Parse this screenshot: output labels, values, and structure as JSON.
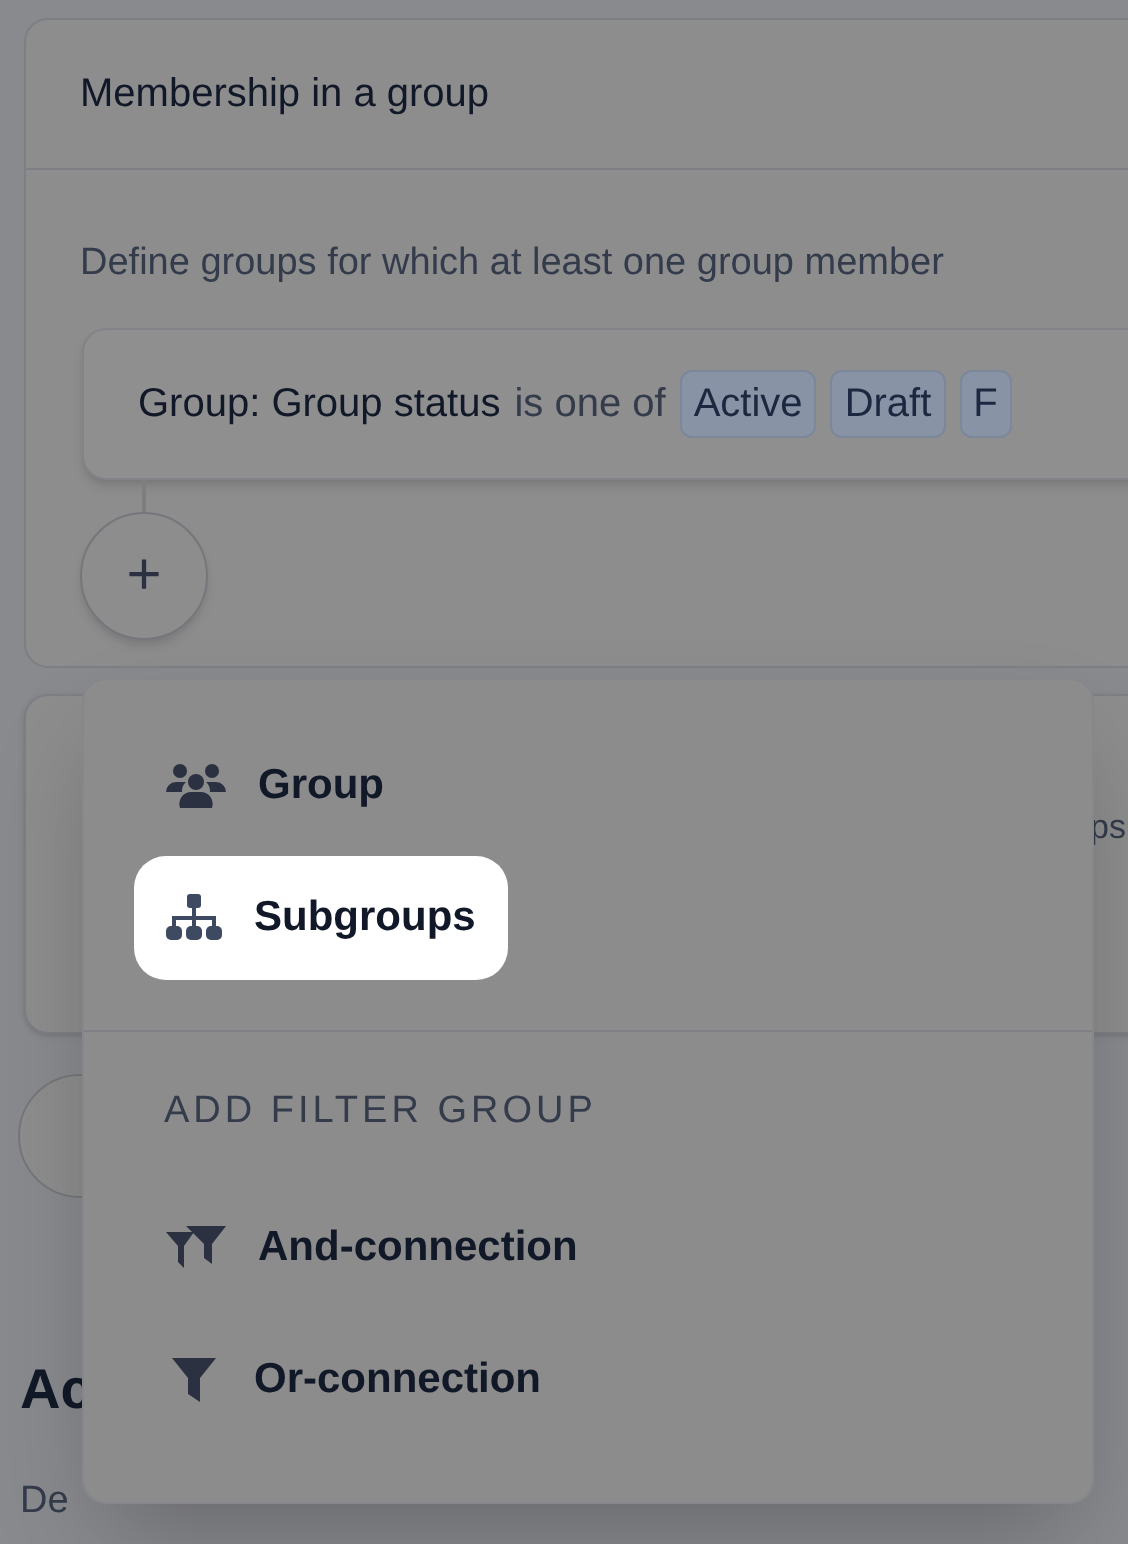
{
  "card": {
    "title": "Membership in a group",
    "description": "Define groups for which at least one group member",
    "filter": {
      "field_label": "Group:",
      "field": "Group status",
      "operator": "is one of",
      "values": [
        "Active",
        "Draft",
        "F"
      ]
    },
    "add_button": {
      "label": "+"
    }
  },
  "second_card": {
    "text_fragment": "ps"
  },
  "actions": {
    "heading": "Ac",
    "description": "De"
  },
  "menu": {
    "sections": [
      {
        "items": [
          {
            "label": "Group",
            "selected": false
          },
          {
            "label": "Subgroups",
            "selected": true
          }
        ]
      },
      {
        "header": "ADD FILTER GROUP",
        "items": [
          {
            "label": "And-connection",
            "selected": false
          },
          {
            "label": "Or-connection",
            "selected": false
          }
        ]
      }
    ]
  }
}
